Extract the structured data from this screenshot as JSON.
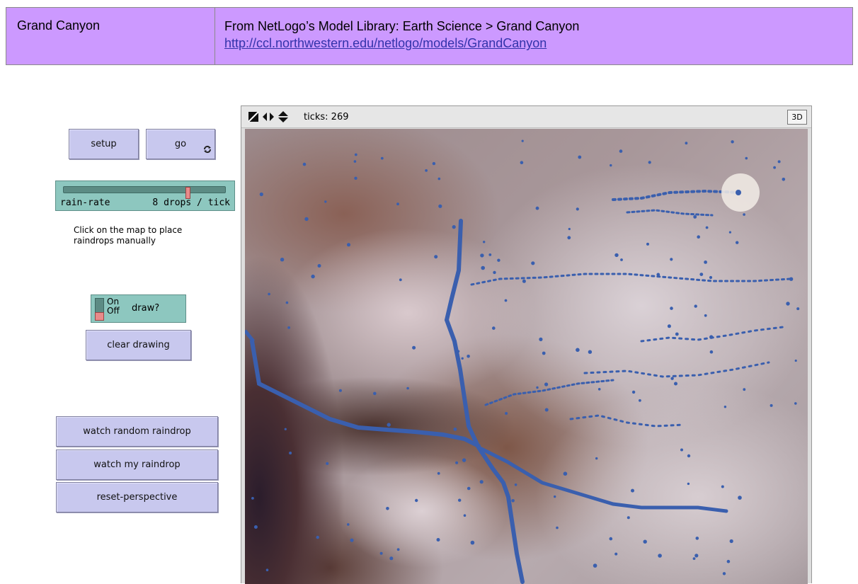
{
  "header": {
    "model_name": "Grand Canyon",
    "source_text": "From NetLogo’s Model Library: Earth Science > Grand Canyon",
    "source_link": "http://ccl.northwestern.edu/netlogo/models/GrandCanyon"
  },
  "controls": {
    "setup_label": "setup",
    "go_label": "go",
    "go_forever_icon": "forever-arrows-icon",
    "slider": {
      "label": "rain-rate",
      "value_text": "8 drops / tick",
      "level": 0.78
    },
    "note": "Click on the map to place raindrops manually",
    "switch": {
      "on_label": "On",
      "off_label": "Off",
      "label": "draw?",
      "state": "off"
    },
    "clear_drawing_label": "clear drawing",
    "watch_random_label": "watch random raindrop",
    "watch_mine_label": "watch my raindrop",
    "reset_perspective_label": "reset-perspective"
  },
  "view": {
    "ticks_text": "ticks: 269",
    "three_d_label": "3D",
    "toolbar_icons": [
      "edit-size-icon",
      "horizontal-resize-icon",
      "vertical-resize-icon"
    ],
    "raindrop_color": "#3a5fae",
    "highlight_color": "#f2ece6"
  }
}
